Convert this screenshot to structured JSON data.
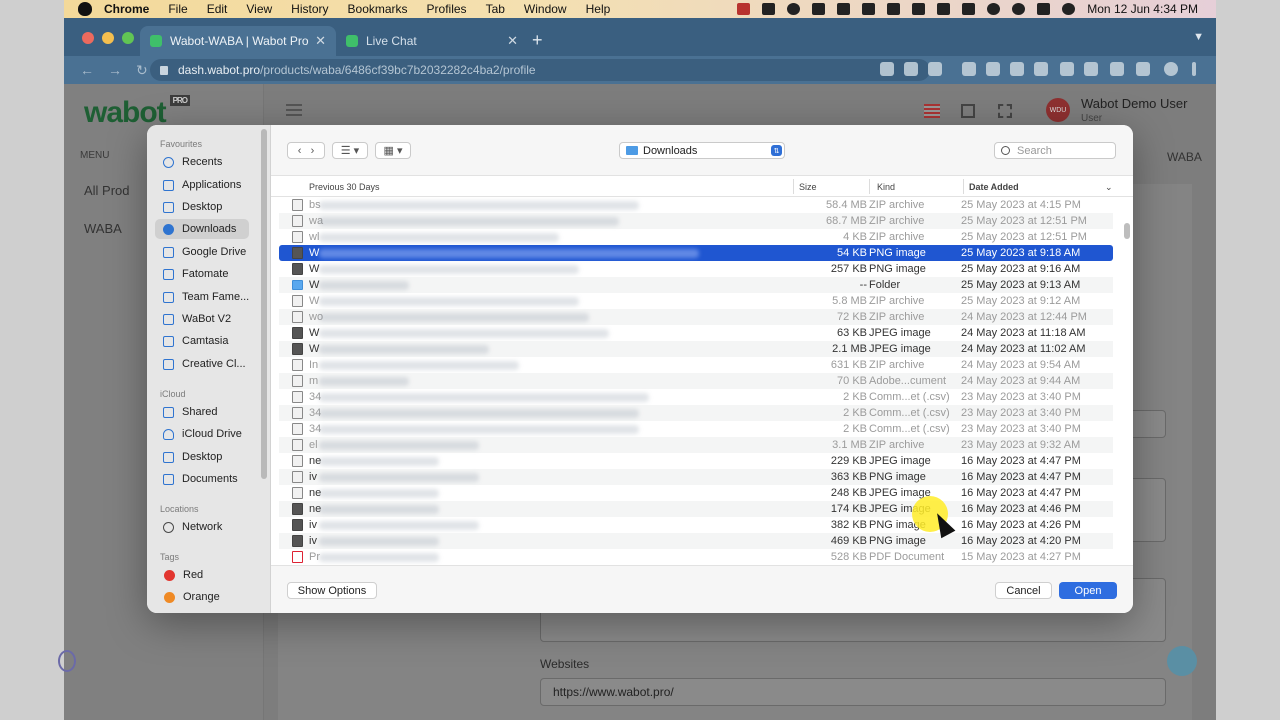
{
  "menubar": {
    "app": "Chrome",
    "items": [
      "File",
      "Edit",
      "View",
      "History",
      "Bookmarks",
      "Profiles",
      "Tab",
      "Window",
      "Help"
    ],
    "clock": "Mon 12 Jun  4:34 PM"
  },
  "browser": {
    "tabs": [
      {
        "title": "Wabot-WABA | Wabot Pro - W",
        "active": true
      },
      {
        "title": "Live Chat",
        "active": false
      }
    ],
    "url_host": "dash.wabot.pro",
    "url_path": "/products/waba/6486cf39bc7b2032282c4ba2/profile"
  },
  "site": {
    "logo": "wabot",
    "logo_badge": "PRO",
    "menu_label": "MENU",
    "nav": [
      "All Prod",
      "WABA"
    ],
    "user_initials": "WDU",
    "user_name": "Wabot Demo User",
    "user_role": "User",
    "breadcrumb": "WABA",
    "websites_label": "Websites",
    "websites_value": "https://www.wabot.pro/"
  },
  "dialog": {
    "sidebar": {
      "favourites_label": "Favourites",
      "favourites": [
        "Recents",
        "Applications",
        "Desktop",
        "Downloads",
        "Google Drive",
        "Fatomate",
        "Team Fame...",
        "WaBot V2",
        "Camtasia",
        "Creative Cl..."
      ],
      "icloud_label": "iCloud",
      "icloud": [
        "Shared",
        "iCloud Drive",
        "Desktop",
        "Documents"
      ],
      "locations_label": "Locations",
      "locations": [
        "Network"
      ],
      "tags_label": "Tags",
      "tags": [
        "Red",
        "Orange"
      ]
    },
    "location": "Downloads",
    "search_placeholder": "Search",
    "columns": {
      "name": "Previous 30 Days",
      "size": "Size",
      "kind": "Kind",
      "date": "Date Added"
    },
    "rows": [
      {
        "n": "bs",
        "size": "58.4 MB",
        "kind": "ZIP archive",
        "date": "25 May 2023 at 4:15 PM",
        "icon": "file",
        "dim": true,
        "w": 320
      },
      {
        "n": "wa",
        "size": "68.7 MB",
        "kind": "ZIP archive",
        "date": "25 May 2023 at 12:51 PM",
        "icon": "file",
        "dim": true,
        "w": 300
      },
      {
        "n": "wl",
        "size": "4 KB",
        "kind": "ZIP archive",
        "date": "25 May 2023 at 12:51 PM",
        "icon": "file",
        "dim": true,
        "w": 240
      },
      {
        "n": "W",
        "size": "54 KB",
        "kind": "PNG image",
        "date": "25 May 2023 at 9:18 AM",
        "icon": "img",
        "dim": false,
        "sel": true,
        "w": 380
      },
      {
        "n": "W",
        "size": "257 KB",
        "kind": "PNG image",
        "date": "25 May 2023 at 9:16 AM",
        "icon": "img",
        "dim": false,
        "w": 260
      },
      {
        "n": "W",
        "size": "--",
        "kind": "Folder",
        "date": "25 May 2023 at 9:13 AM",
        "icon": "folder",
        "dim": false,
        "w": 90
      },
      {
        "n": "W",
        "size": "5.8 MB",
        "kind": "ZIP archive",
        "date": "25 May 2023 at 9:12 AM",
        "icon": "file",
        "dim": true,
        "w": 260
      },
      {
        "n": "wo",
        "size": "72 KB",
        "kind": "ZIP archive",
        "date": "24 May 2023 at 12:44 PM",
        "icon": "file",
        "dim": true,
        "w": 270
      },
      {
        "n": "W",
        "size": "63 KB",
        "kind": "JPEG image",
        "date": "24 May 2023 at 11:18 AM",
        "icon": "img",
        "dim": false,
        "w": 290
      },
      {
        "n": "W",
        "size": "2.1 MB",
        "kind": "JPEG image",
        "date": "24 May 2023 at 11:02 AM",
        "icon": "img",
        "dim": false,
        "w": 170
      },
      {
        "n": "In",
        "size": "631 KB",
        "kind": "ZIP archive",
        "date": "24 May 2023 at 9:54 AM",
        "icon": "file",
        "dim": true,
        "w": 200
      },
      {
        "n": "m",
        "size": "70 KB",
        "kind": "Adobe...cument",
        "date": "24 May 2023 at 9:44 AM",
        "icon": "file",
        "dim": true,
        "w": 90
      },
      {
        "n": "34",
        "size": "2 KB",
        "kind": "Comm...et (.csv)",
        "date": "23 May 2023 at 3:40 PM",
        "icon": "file",
        "dim": true,
        "w": 330
      },
      {
        "n": "34",
        "size": "2 KB",
        "kind": "Comm...et (.csv)",
        "date": "23 May 2023 at 3:40 PM",
        "icon": "file",
        "dim": true,
        "w": 320
      },
      {
        "n": "34",
        "size": "2 KB",
        "kind": "Comm...et (.csv)",
        "date": "23 May 2023 at 3:40 PM",
        "icon": "file",
        "dim": true,
        "w": 320
      },
      {
        "n": "el",
        "size": "3.1 MB",
        "kind": "ZIP archive",
        "date": "23 May 2023 at 9:32 AM",
        "icon": "file",
        "dim": true,
        "w": 160
      },
      {
        "n": "ne",
        "size": "229 KB",
        "kind": "JPEG image",
        "date": "16 May 2023 at 4:47 PM",
        "icon": "file",
        "dim": false,
        "w": 120
      },
      {
        "n": "iv",
        "size": "363 KB",
        "kind": "PNG image",
        "date": "16 May 2023 at 4:47 PM",
        "icon": "file",
        "dim": false,
        "w": 160
      },
      {
        "n": "ne",
        "size": "248 KB",
        "kind": "JPEG image",
        "date": "16 May 2023 at 4:47 PM",
        "icon": "file",
        "dim": false,
        "w": 120
      },
      {
        "n": "ne",
        "size": "174 KB",
        "kind": "JPEG image",
        "date": "16 May 2023 at 4:46 PM",
        "icon": "img",
        "dim": false,
        "w": 120
      },
      {
        "n": "iv",
        "size": "382 KB",
        "kind": "PNG image",
        "date": "16 May 2023 at 4:26 PM",
        "icon": "img",
        "dim": false,
        "w": 160
      },
      {
        "n": "iv",
        "size": "469 KB",
        "kind": "PNG image",
        "date": "16 May 2023 at 4:20 PM",
        "icon": "img",
        "dim": false,
        "w": 120
      },
      {
        "n": "Pr",
        "size": "528 KB",
        "kind": "PDF Document",
        "date": "15 May 2023 at 4:27 PM",
        "icon": "pdf",
        "dim": true,
        "w": 120
      }
    ],
    "show_options": "Show Options",
    "cancel": "Cancel",
    "open": "Open"
  },
  "colors": {
    "accent": "#2e6de0",
    "selection": "#1f56d1",
    "tab_bar": "#3a5f80"
  }
}
